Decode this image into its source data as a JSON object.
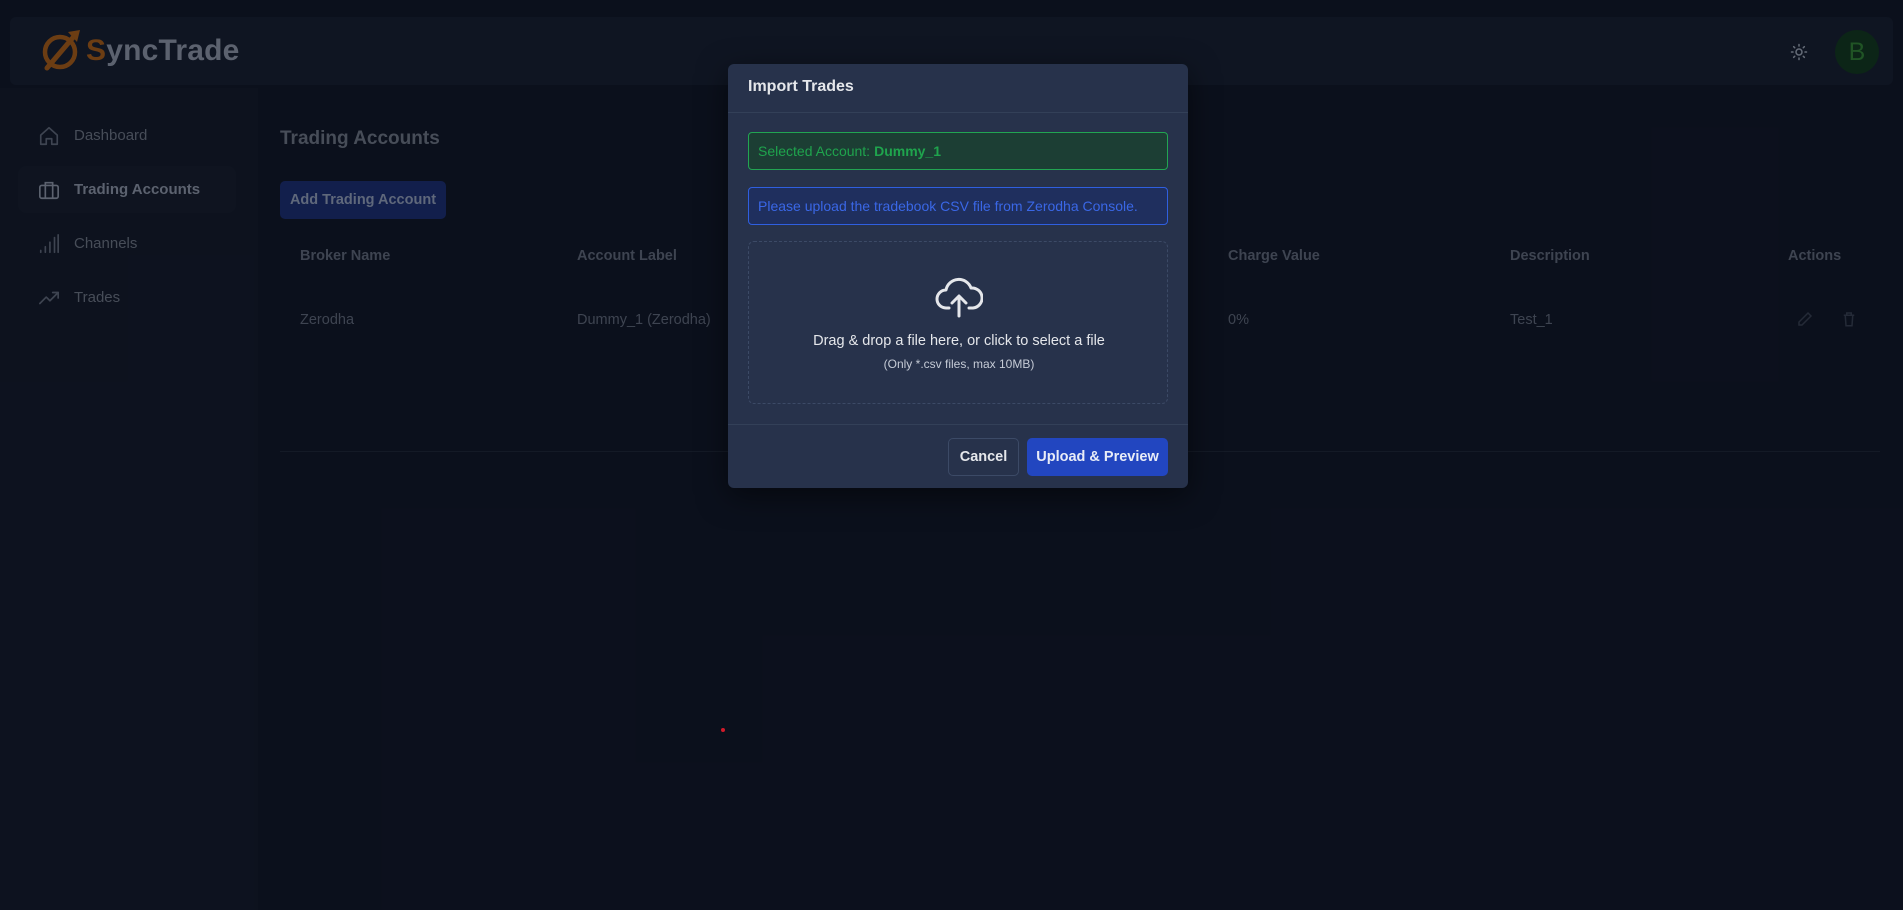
{
  "app": {
    "logo_text_s": "S",
    "logo_text_rest": "yncTrade",
    "avatar_initial": "B",
    "theme_icon": "sun-icon"
  },
  "sidebar": {
    "items": [
      {
        "label": "Dashboard",
        "icon": "home-icon",
        "active": false
      },
      {
        "label": "Trading Accounts",
        "icon": "briefcase-icon",
        "active": true
      },
      {
        "label": "Channels",
        "icon": "signal-bars-icon",
        "active": false
      },
      {
        "label": "Trades",
        "icon": "trending-up-icon",
        "active": false
      }
    ]
  },
  "main": {
    "page_title": "Trading Accounts",
    "add_button_label": "Add Trading Account",
    "table": {
      "headers": [
        "Broker Name",
        "Account Label",
        "Charge Value",
        "Description",
        "Actions"
      ],
      "rows": [
        {
          "broker": "Zerodha",
          "label": "Dummy_1 (Zerodha)",
          "charge": "0%",
          "description": "Test_1",
          "actions": [
            "edit-icon",
            "delete-icon"
          ]
        }
      ]
    }
  },
  "modal": {
    "title": "Import Trades",
    "selected_account_prefix": "Selected Account:",
    "selected_account_value": "Dummy_1",
    "info_text": "Please upload the tradebook CSV file from Zerodha Console.",
    "dropzone": {
      "icon": "cloud-upload-icon",
      "text": "Drag & drop a file here, or click to select a file",
      "subtext": "(Only *.csv files, max 10MB)"
    },
    "cancel_label": "Cancel",
    "upload_label": "Upload & Preview"
  },
  "colors": {
    "background": "#0f1524",
    "modal": "#27324b",
    "primary": "#2246c0",
    "success": "#1fa44d",
    "brand_orange": "#a45a16"
  }
}
